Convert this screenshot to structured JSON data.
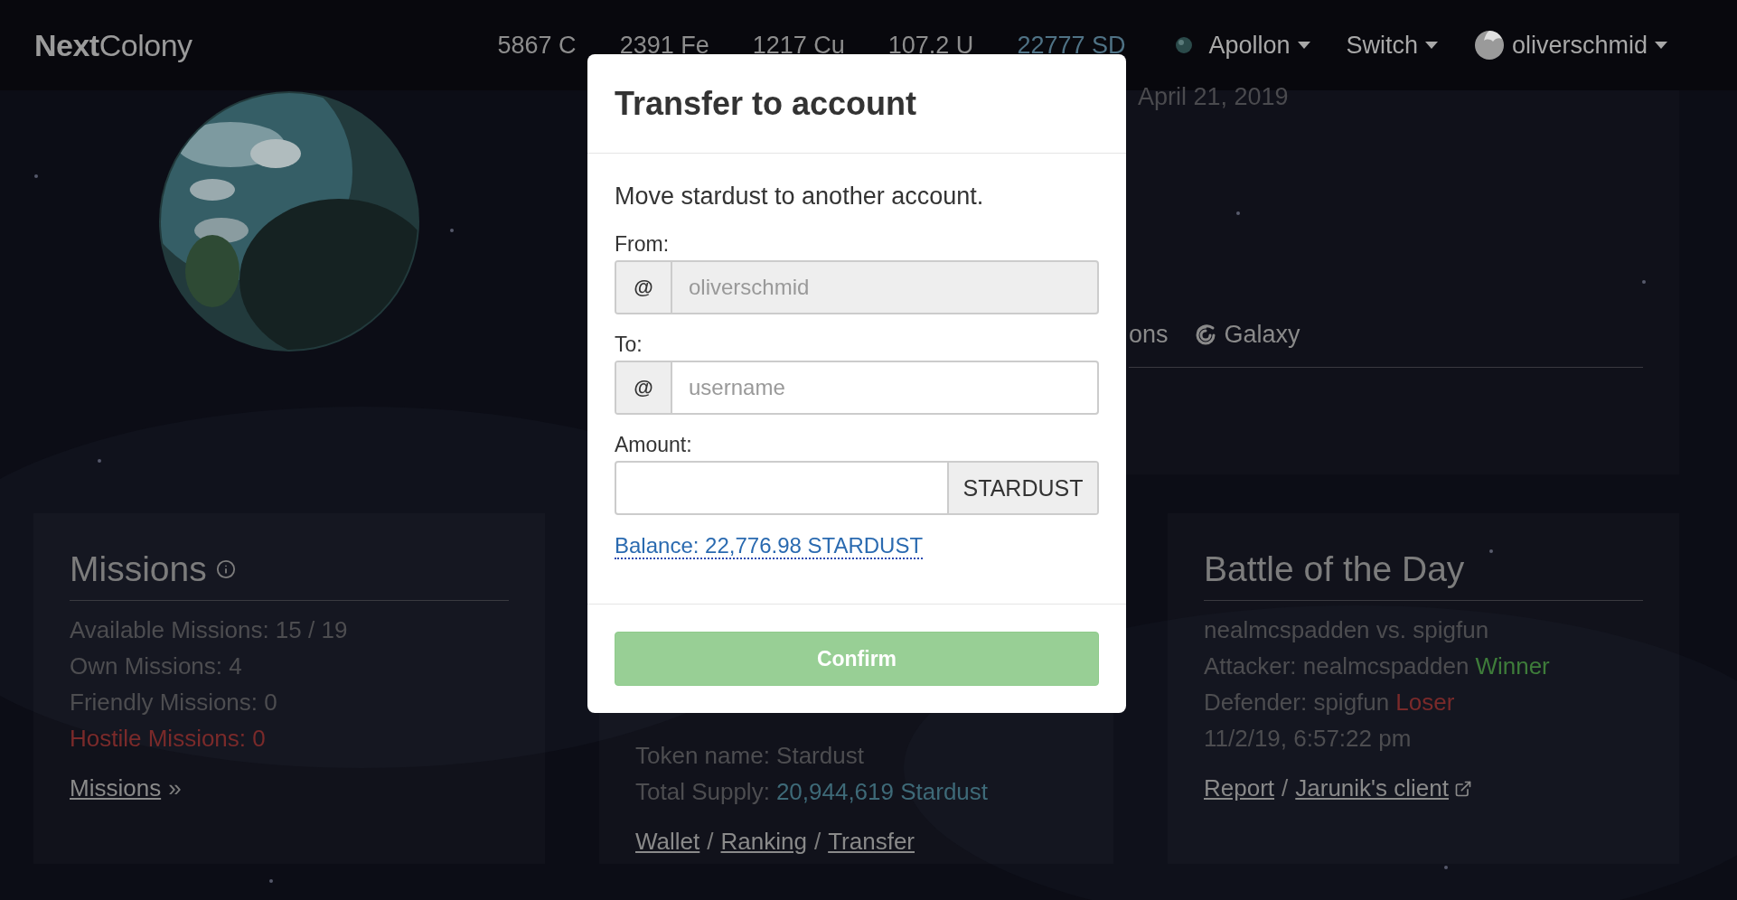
{
  "navbar": {
    "logo_bold": "Next",
    "logo_light": "Colony",
    "resources": [
      {
        "text": "5867 C",
        "kind": "plain"
      },
      {
        "text": "2391 Fe",
        "kind": "plain"
      },
      {
        "text": "1217 Cu",
        "kind": "plain"
      },
      {
        "text": "107.2 U",
        "kind": "plain"
      },
      {
        "text": "22777 SD",
        "kind": "stardust"
      }
    ],
    "planet_menu": "Apollon",
    "switch_menu": "Switch",
    "user_menu": "oliverschmid"
  },
  "planet_panel": {
    "date": "April 21, 2019",
    "tabs": [
      {
        "label": "ons",
        "kind": "text"
      },
      {
        "label": "Galaxy",
        "kind": "galaxy"
      }
    ]
  },
  "missions": {
    "title": "Missions",
    "lines": [
      {
        "text": "Available Missions: 15 / 19",
        "kind": "normal"
      },
      {
        "text": "Own Missions: 4",
        "kind": "normal"
      },
      {
        "text": "Friendly Missions: 0",
        "kind": "normal"
      },
      {
        "text": "Hostile Missions: 0",
        "kind": "alert"
      }
    ],
    "link": "Missions",
    "link_suffix": "»"
  },
  "stardust": {
    "lines": [
      {
        "label": "Token name: Stardust"
      },
      {
        "label": "Total Supply:",
        "value": "20,944,619 Stardust"
      }
    ],
    "links": [
      "Wallet",
      "Ranking",
      "Transfer"
    ],
    "separator": "/"
  },
  "battle": {
    "title": "Battle of the Day",
    "lines": [
      {
        "text": "nealmcspadden vs. spigfun",
        "kind": "normal"
      },
      {
        "text": "Attacker: nealmcspadden",
        "tag": "Winner",
        "kind": "win"
      },
      {
        "text": "Defender: spigfun",
        "tag": "Loser",
        "kind": "lose"
      },
      {
        "text": "11/2/19, 6:57:22 pm",
        "kind": "normal"
      }
    ],
    "links": [
      {
        "text": "Report",
        "external": false
      },
      {
        "text": "Jarunik's client",
        "external": true
      }
    ],
    "separator": "/"
  },
  "modal": {
    "title": "Transfer to account",
    "description": "Move stardust to another account.",
    "fields": [
      {
        "label": "From:",
        "addon": "@",
        "value": "oliverschmid",
        "disabled": true
      },
      {
        "label": "To:",
        "addon": "@",
        "placeholder": "username",
        "disabled": false
      },
      {
        "label": "Amount:",
        "suffix": "STARDUST",
        "disabled": false
      }
    ],
    "balance": "Balance: 22,776.98 STARDUST",
    "confirm": {
      "label": "Confirm",
      "disabled": true
    }
  }
}
